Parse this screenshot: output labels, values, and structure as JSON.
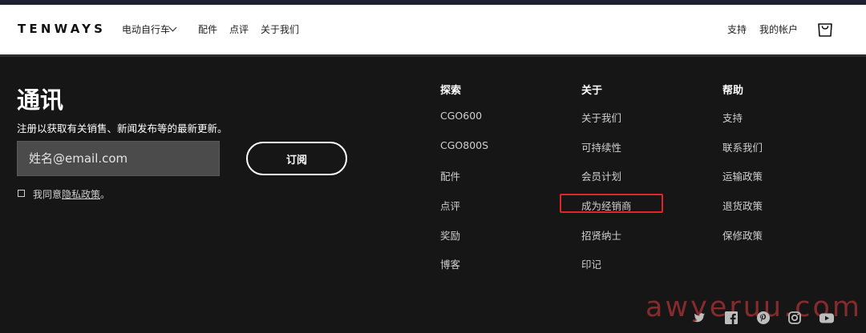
{
  "header": {
    "logo": "TENWAYS",
    "nav": {
      "bikes": "电动自行车",
      "accessories": "配件",
      "reviews": "点评",
      "about": "关于我们",
      "support": "支持",
      "account": "我的帐户"
    }
  },
  "newsletter": {
    "title": "通讯",
    "description": "注册以获取有关销售、新闻发布等的最新更新。",
    "email_placeholder": "姓名@email.com",
    "subscribe_label": "订阅",
    "agree_prefix": "我同意",
    "privacy_link": "隐私政策",
    "agree_suffix": "。"
  },
  "footer": {
    "explore": {
      "heading": "探索",
      "links": [
        "CGO600",
        "CGO800S",
        "配件",
        "点评",
        "奖励",
        "博客"
      ]
    },
    "about": {
      "heading": "关于",
      "links": [
        "关于我们",
        "可持续性",
        "会员计划",
        "成为经销商",
        "招贤纳士",
        "印记"
      ]
    },
    "help": {
      "heading": "帮助",
      "links": [
        "支持",
        "联系我们",
        "运输政策",
        "退货政策",
        "保修政策"
      ]
    }
  },
  "highlight_color": "#e0242a",
  "social_icons": [
    "twitter-icon",
    "facebook-icon",
    "pinterest-icon",
    "instagram-icon",
    "youtube-icon"
  ],
  "watermark": "awyeruu.com"
}
